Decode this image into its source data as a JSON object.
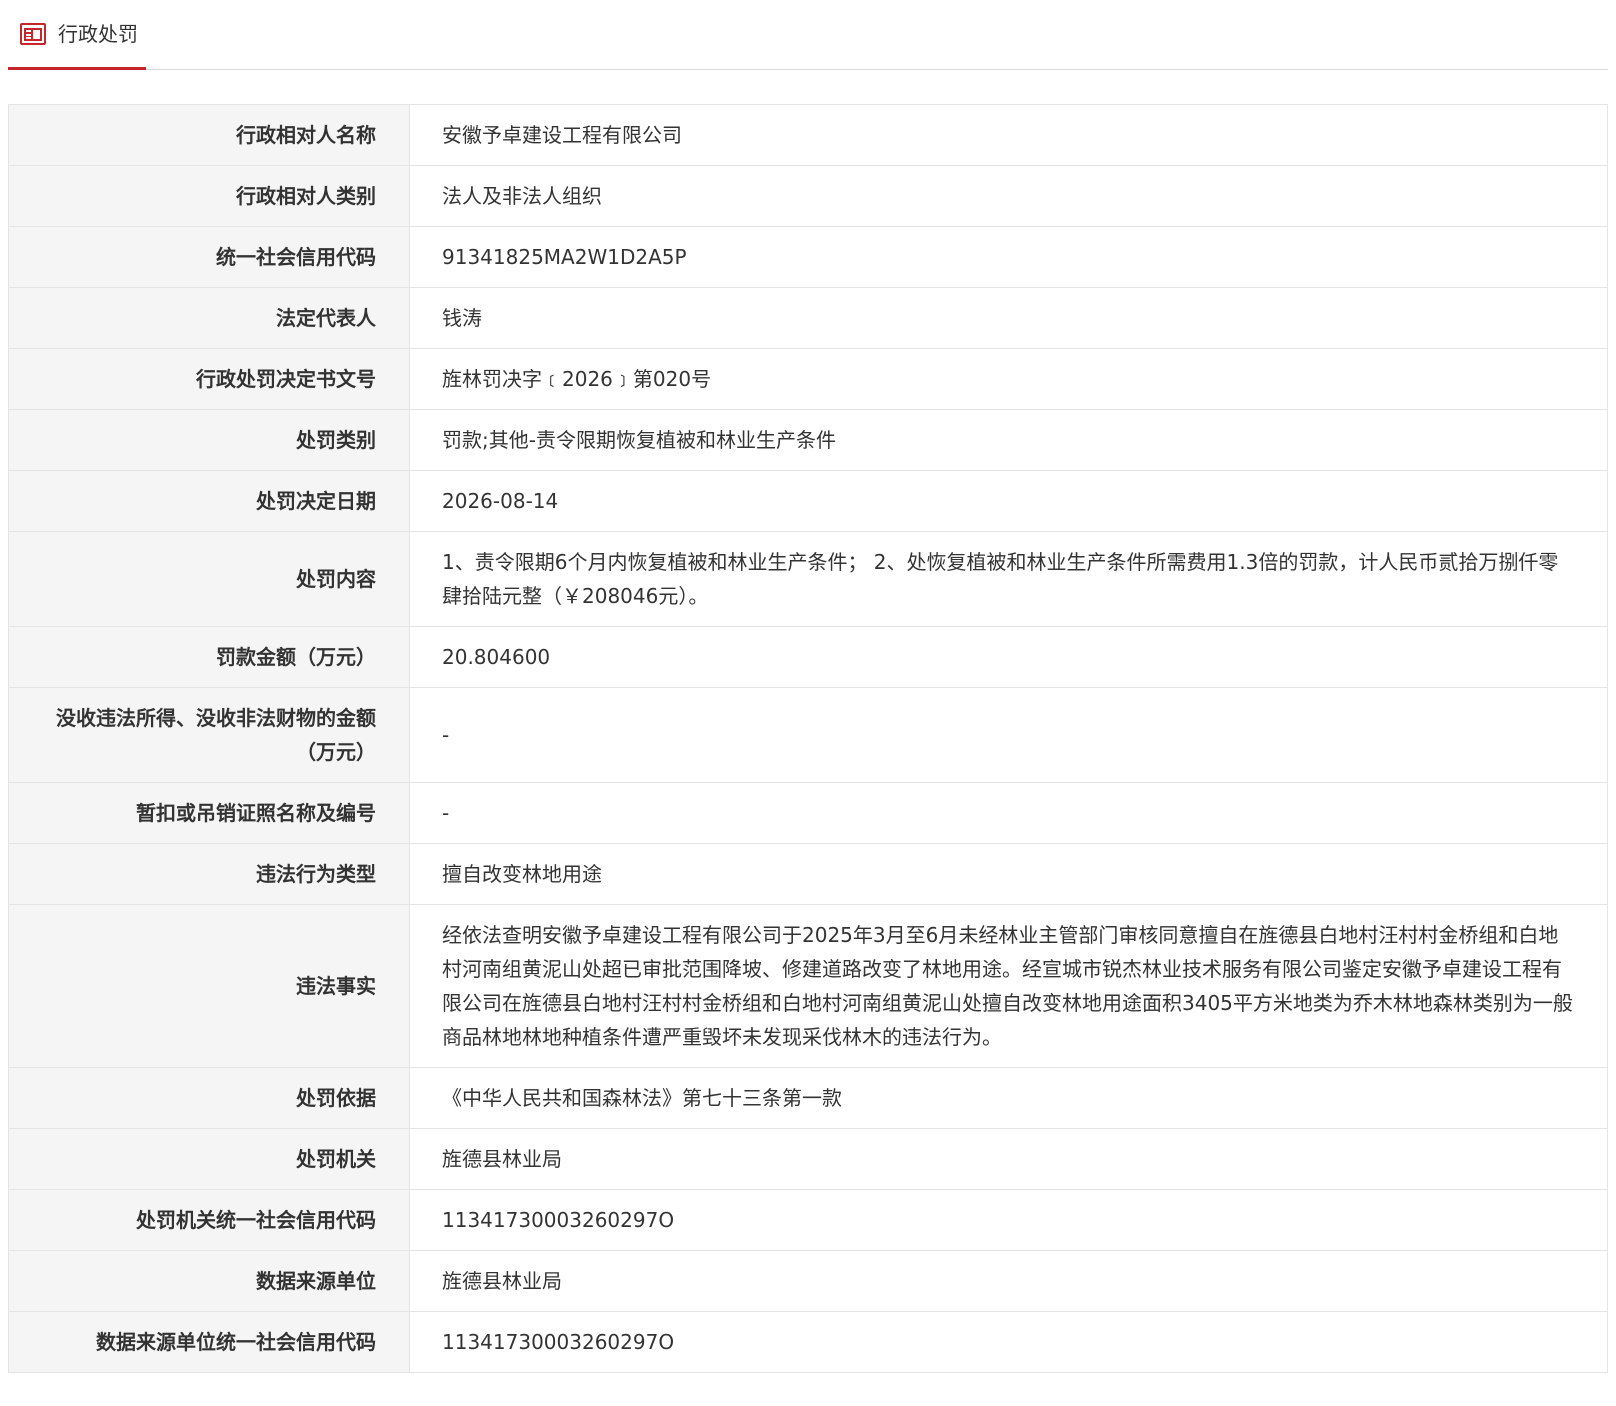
{
  "header": {
    "title": "行政处罚",
    "icon": "document-list-icon",
    "accent_color": "#c6252c"
  },
  "rows": [
    {
      "label": "行政相对人名称",
      "value": "安徽予卓建设工程有限公司"
    },
    {
      "label": "行政相对人类别",
      "value": "法人及非法人组织"
    },
    {
      "label": "统一社会信用代码",
      "value": "91341825MA2W1D2A5P"
    },
    {
      "label": "法定代表人",
      "value": "钱涛"
    },
    {
      "label": "行政处罚决定书文号",
      "value": "旌林罚决字﹝2026﹞第020号"
    },
    {
      "label": "处罚类别",
      "value": "罚款;其他-责令限期恢复植被和林业生产条件"
    },
    {
      "label": "处罚决定日期",
      "value": "2026-08-14"
    },
    {
      "label": "处罚内容",
      "value": "1、责令限期6个月内恢复植被和林业生产条件； 2、处恢复植被和林业生产条件所需费用1.3倍的罚款，计人民币贰拾万捌仟零肆拾陆元整（￥208046元）。"
    },
    {
      "label": "罚款金额（万元）",
      "value": "20.804600"
    },
    {
      "label": "没收违法所得、没收非法财物的金额（万元）",
      "value": "-"
    },
    {
      "label": "暂扣或吊销证照名称及编号",
      "value": "-"
    },
    {
      "label": "违法行为类型",
      "value": "擅自改变林地用途"
    },
    {
      "label": "违法事实",
      "value": "经依法查明安徽予卓建设工程有限公司于2025年3月至6月未经林业主管部门审核同意擅自在旌德县白地村汪村村金桥组和白地村河南组黄泥山处超已审批范围降坡、修建道路改变了林地用途。经宣城市锐杰林业技术服务有限公司鉴定安徽予卓建设工程有限公司在旌德县白地村汪村村金桥组和白地村河南组黄泥山处擅自改变林地用途面积3405平方米地类为乔木林地森林类别为一般商品林地林地种植条件遭严重毁坏未发现采伐林木的违法行为。"
    },
    {
      "label": "处罚依据",
      "value": "《中华人民共和国森林法》第七十三条第一款"
    },
    {
      "label": "处罚机关",
      "value": "旌德县林业局"
    },
    {
      "label": "处罚机关统一社会信用代码",
      "value": "11341730003260297O"
    },
    {
      "label": "数据来源单位",
      "value": "旌德县林业局"
    },
    {
      "label": "数据来源单位统一社会信用代码",
      "value": "11341730003260297O"
    }
  ]
}
